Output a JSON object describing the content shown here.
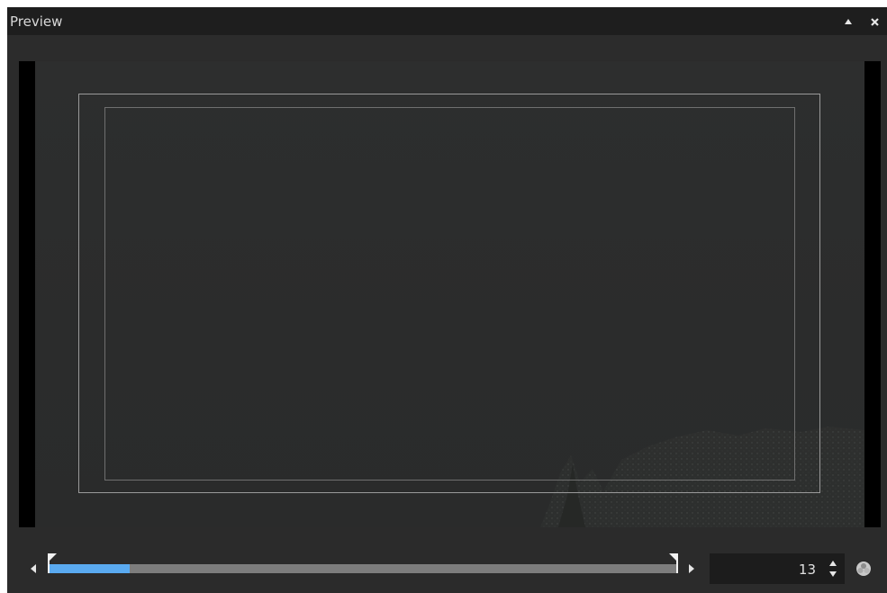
{
  "window": {
    "title": "Preview",
    "buttons": [
      {
        "icon": "collapse-up-icon"
      },
      {
        "icon": "close-icon"
      }
    ]
  },
  "preview": {
    "safe_frames": [
      "title-safe",
      "action-safe"
    ]
  },
  "timeline": {
    "range_start_handle": "range-start-marker",
    "range_end_handle": "range-end-marker",
    "progress_fraction": 0.13
  },
  "frame": {
    "value": "13"
  },
  "colors": {
    "titlebar": "#1e1e1e",
    "panel": "#2b2b2b",
    "accent": "#5aaaf0",
    "track": "#7d7d7d"
  }
}
